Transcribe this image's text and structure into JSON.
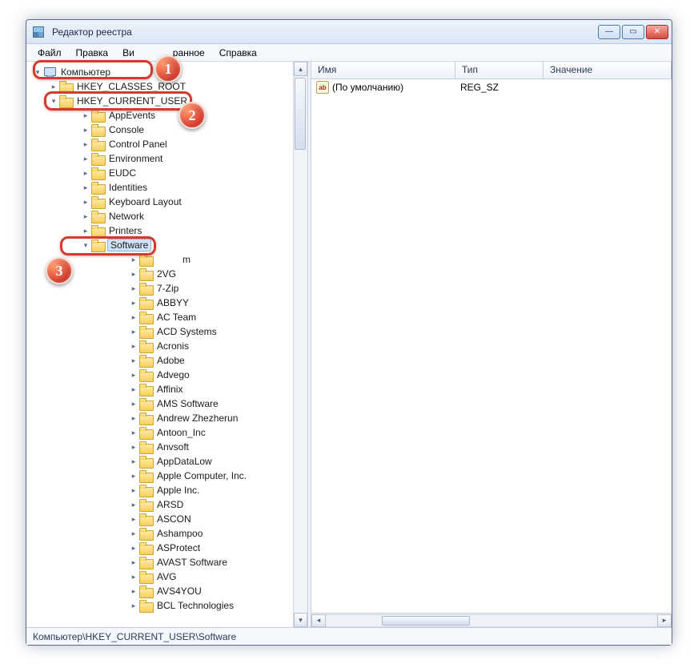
{
  "window": {
    "title": "Редактор реестра"
  },
  "menu": {
    "file": "Файл",
    "edit": "Правка",
    "view": "Ви",
    "fav": "ранное",
    "help": "Справка"
  },
  "tree": {
    "root": "Компьютер",
    "hkcr": "HKEY_CLASSES_ROOT",
    "hkcu": "HKEY_CURRENT_USER",
    "hkcu_children": [
      "AppEvents",
      "Console",
      "Control Panel",
      "Environment",
      "EUDC",
      "Identities",
      "Keyboard Layout",
      "Network",
      "Printers"
    ],
    "software": "Software",
    "software_first_partial": "m",
    "software_children": [
      "2VG",
      "7-Zip",
      "ABBYY",
      "AC Team",
      "ACD Systems",
      "Acronis",
      "Adobe",
      "Advego",
      "Affinix",
      "AMS Software",
      "Andrew Zhezherun",
      "Antoon_Inc",
      "Anvsoft",
      "AppDataLow",
      "Apple Computer, Inc.",
      "Apple Inc.",
      "ARSD",
      "ASCON",
      "Ashampoo",
      "ASProtect",
      "AVAST Software",
      "AVG",
      "AVS4YOU",
      "BCL Technologies"
    ]
  },
  "columns": {
    "name": "Имя",
    "type": "Тип",
    "value": "Значение"
  },
  "values": {
    "default_name": "(По умолчанию)",
    "default_type": "REG_SZ"
  },
  "status": "Компьютер\\HKEY_CURRENT_USER\\Software",
  "callouts": {
    "n1": "1",
    "n2": "2",
    "n3": "3"
  }
}
